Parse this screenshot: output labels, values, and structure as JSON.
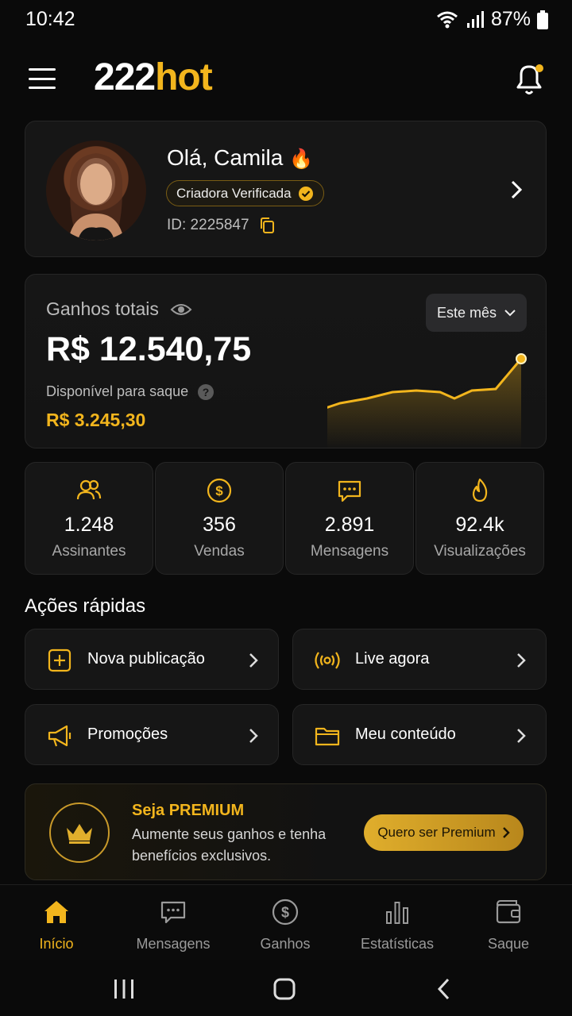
{
  "status": {
    "time": "10:42",
    "battery": "87%"
  },
  "header": {
    "logo_num": "222",
    "logo_hot": "hot",
    "notification_dot": true
  },
  "profile": {
    "greeting": "Olá, Camila",
    "badge": "Criadora Verificada",
    "id_text": "ID: 2225847"
  },
  "earnings": {
    "label": "Ganhos totais",
    "total": "R$ 12.540,75",
    "available_label": "Disponível para saque",
    "available": "R$ 3.245,30",
    "period": "Este mês"
  },
  "stats": [
    {
      "value": "1.248",
      "label": "Assinantes",
      "icon": "users-icon"
    },
    {
      "value": "356",
      "label": "Vendas",
      "icon": "dollar-icon"
    },
    {
      "value": "2.891",
      "label": "Mensagens",
      "icon": "message-icon"
    },
    {
      "value": "92.4k",
      "label": "Visualizações",
      "icon": "flame-icon"
    }
  ],
  "quick_actions": {
    "title": "Ações rápidas",
    "items": [
      {
        "label": "Nova publicação",
        "icon": "plus-square-icon"
      },
      {
        "label": "Live agora",
        "icon": "broadcast-icon"
      },
      {
        "label": "Promoções",
        "icon": "megaphone-icon"
      },
      {
        "label": "Meu conteúdo",
        "icon": "folder-icon"
      }
    ]
  },
  "premium": {
    "title": "Seja PREMIUM",
    "description": "Aumente seus ganhos e tenha benefícios exclusivos.",
    "cta": "Quero ser Premium"
  },
  "nav": [
    {
      "label": "Início",
      "active": true
    },
    {
      "label": "Mensagens",
      "active": false
    },
    {
      "label": "Ganhos",
      "active": false
    },
    {
      "label": "Estatísticas",
      "active": false
    },
    {
      "label": "Saque",
      "active": false
    }
  ],
  "colors": {
    "accent": "#f2b51d",
    "background": "#0a0a0a",
    "card": "#161616"
  }
}
